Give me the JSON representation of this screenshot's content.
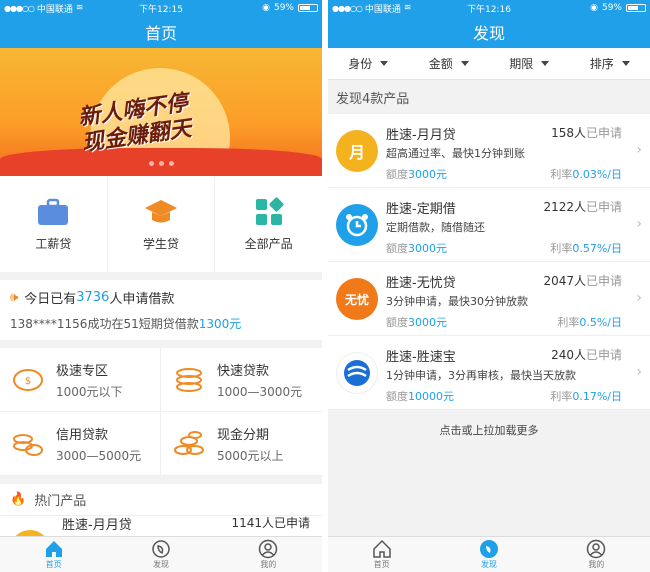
{
  "status": {
    "carrier": "中国联通",
    "left_time": "下午12:15",
    "right_time": "下午12:16",
    "battery": "59%"
  },
  "home": {
    "title": "首页",
    "banner_text_line1": "新人嗨不停",
    "banner_text_line2": "现金赚翻天",
    "categories": [
      {
        "label": "工薪贷",
        "icon": "briefcase-icon",
        "color": "#5b8dde"
      },
      {
        "label": "学生贷",
        "icon": "graduation-cap-icon",
        "color": "#f08a24"
      },
      {
        "label": "全部产品",
        "icon": "apps-grid-icon",
        "color": "#2bb5a5"
      }
    ],
    "notice": {
      "prefix": "今日已有",
      "count": "3736",
      "suffix": "人申请借款",
      "detail_prefix": "138****1156成功在51短期贷借款",
      "detail_amount": "1300元"
    },
    "zones": [
      {
        "title": "极速专区",
        "sub": "1000元以下"
      },
      {
        "title": "快速贷款",
        "sub": "1000—3000元"
      },
      {
        "title": "信用贷款",
        "sub": "3000—5000元"
      },
      {
        "title": "现金分期",
        "sub": "5000元以上"
      }
    ],
    "hot_label": "热门产品",
    "hot_item": {
      "name": "胜速-月月贷",
      "count": "1141人已申请"
    }
  },
  "discover": {
    "title": "发现",
    "filters": [
      "身份",
      "金额",
      "期限",
      "排序"
    ],
    "found_text": "发现4款产品",
    "products": [
      {
        "name": "胜速-月月贷",
        "count": "158人",
        "applied": "已申请",
        "desc": "超高通过率、最快1分钟到账",
        "amount_label": "额度",
        "amount": "3000元",
        "rate_label": "利率",
        "rate": "0.03%/日",
        "avatar_text": "月",
        "avatar_color": "#f5b21f"
      },
      {
        "name": "胜速-定期借",
        "count": "2122人",
        "applied": "已申请",
        "desc": "定期借款，随借随还",
        "amount_label": "额度",
        "amount": "3000元",
        "rate_label": "利率",
        "rate": "0.57%/日",
        "avatar_text": "⏰",
        "avatar_color": "#1fa0e8"
      },
      {
        "name": "胜速-无忧贷",
        "count": "2047人",
        "applied": "已申请",
        "desc": "3分钟申请，最快30分钟放款",
        "amount_label": "额度",
        "amount": "3000元",
        "rate_label": "利率",
        "rate": "0.5%/日",
        "avatar_text": "无忧",
        "avatar_color": "#f07a1a"
      },
      {
        "name": "胜速-胜速宝",
        "count": "240人",
        "applied": "已申请",
        "desc": "1分钟申请，3分再审核，最快当天放款",
        "amount_label": "额度",
        "amount": "10000元",
        "rate_label": "利率",
        "rate": "0.17%/日",
        "avatar_text": "S",
        "avatar_color": "#1a6fd6"
      }
    ],
    "load_more": "点击或上拉加载更多"
  },
  "tabs": [
    {
      "label": "首页",
      "icon": "home-icon"
    },
    {
      "label": "发现",
      "icon": "discover-icon"
    },
    {
      "label": "我的",
      "icon": "user-icon"
    }
  ],
  "colors": {
    "accent": "#1fa0e8"
  }
}
